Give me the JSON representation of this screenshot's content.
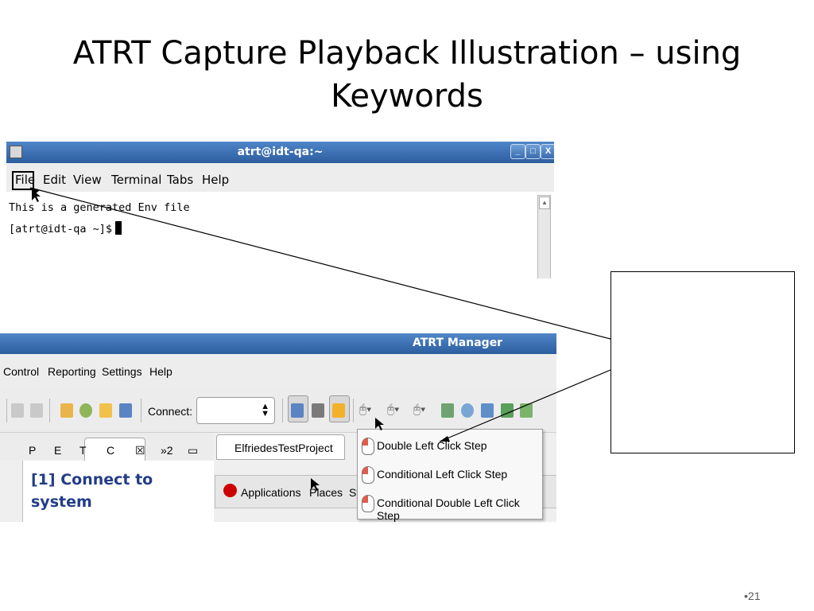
{
  "slide": {
    "title_line1": "ATRT Capture Playback Illustration – using",
    "title_line2": "Keywords",
    "page_number": "•21"
  },
  "terminal": {
    "window_title": "atrt@idt-qa:~",
    "window_buttons": [
      "_",
      "□",
      "X"
    ],
    "menu": [
      "File",
      "Edit",
      "View",
      "Terminal",
      "Tabs",
      "Help"
    ],
    "lines": [
      "This is a generated Env file",
      "[atrt@idt-qa ~]$"
    ]
  },
  "manager": {
    "window_title": "ATRT Manager",
    "menu": [
      "Control",
      "Reporting",
      "Settings",
      "Help"
    ],
    "toolbar": {
      "connect_label": "Connect:",
      "connect_value": ""
    },
    "panel_tabs": [
      "P",
      "E",
      "T",
      "C",
      "»2"
    ],
    "step_text_line1": "[1] Connect to",
    "step_text_line2": "system",
    "editor_tab": "ElfriedesTestProject",
    "inner_bar": {
      "applications": "Applications",
      "places": "Places",
      "system_partial": "Sy"
    },
    "dropdown_items": [
      "Double Left Click Step",
      "Conditional Left Click Step",
      "Conditional Double Left Click Step"
    ]
  }
}
